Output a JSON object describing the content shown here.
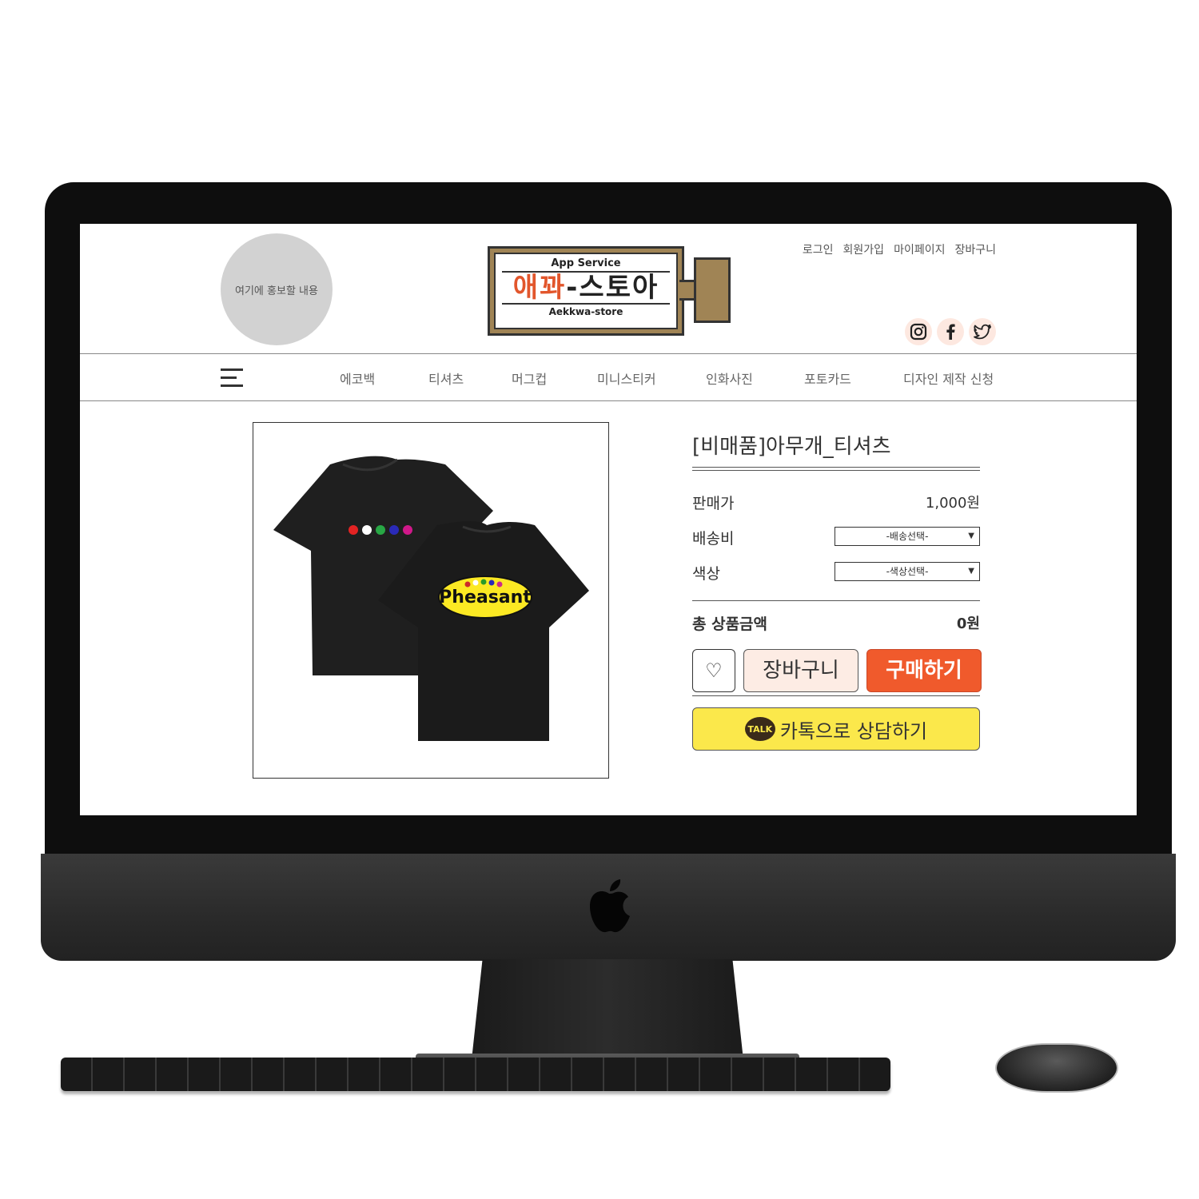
{
  "header": {
    "promo_text": "여기에 홍보할 내용",
    "logo": {
      "top": "App Service",
      "main_accent": "애꽈",
      "main_rest": "-스토아",
      "bottom": "Aekkwa-store"
    },
    "links": [
      "로그인",
      "회원가입",
      "마이페이지",
      "장바구니"
    ],
    "social_icons": [
      "instagram-icon",
      "facebook-icon",
      "twitter-icon"
    ]
  },
  "nav": {
    "items": [
      "에코백",
      "티셔츠",
      "머그컵",
      "미니스티커",
      "인화사진",
      "포토카드",
      "디자인 제작 신청"
    ]
  },
  "product": {
    "image_text": "Pheasant",
    "title": "[비매품]아무개_티셔츠",
    "price_label": "판매가",
    "price_value": "1,000원",
    "shipping_label": "배송비",
    "shipping_select": "-배송선택-",
    "color_label": "색상",
    "color_select": "-색상선택-",
    "total_label": "총 상품금액",
    "total_value": "0원",
    "cart_button": "장바구니",
    "buy_button": "구매하기",
    "kakao_icon_text": "TALK",
    "kakao_button": "카톡으로 상담하기"
  },
  "colors": {
    "accent": "#f05a2c",
    "cart_bg": "#fdece4",
    "kakao": "#fbe84b",
    "promo_circle": "#d2d2d2"
  }
}
